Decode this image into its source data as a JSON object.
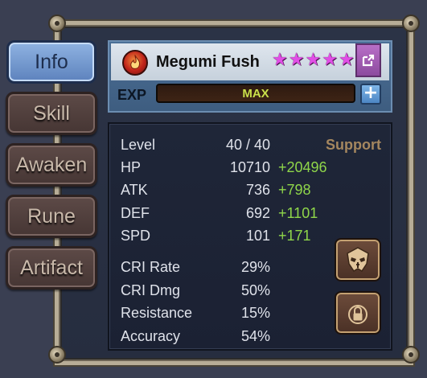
{
  "tabs": [
    {
      "label": "Info",
      "active": true
    },
    {
      "label": "Skill",
      "active": false
    },
    {
      "label": "Awaken",
      "active": false
    },
    {
      "label": "Rune",
      "active": false
    },
    {
      "label": "Artifact",
      "active": false
    }
  ],
  "monster": {
    "name": "Megumi Fush",
    "element_icon": "fire-element-icon",
    "stars": 6,
    "star_color": "#e14fe6"
  },
  "exp": {
    "label": "EXP",
    "bar_text": "MAX",
    "fill_fraction": 1.0
  },
  "role": "Support",
  "stats": [
    {
      "label": "Level",
      "value": "40 / 40",
      "bonus": ""
    },
    {
      "label": "HP",
      "value": "10710",
      "bonus": "+20496"
    },
    {
      "label": "ATK",
      "value": "736",
      "bonus": "+798"
    },
    {
      "label": "DEF",
      "value": "692",
      "bonus": "+1101"
    },
    {
      "label": "SPD",
      "value": "101",
      "bonus": "+171"
    }
  ],
  "secondary_stats": [
    {
      "label": "CRI Rate",
      "value": "29%"
    },
    {
      "label": "CRI Dmg",
      "value": "50%"
    },
    {
      "label": "Resistance",
      "value": "15%"
    },
    {
      "label": "Accuracy",
      "value": "54%"
    }
  ],
  "colors": {
    "active_tab": "#8fb3e2",
    "bonus_green": "#8fd64a",
    "role_text": "#a5875f",
    "exp_text": "#c9e04a"
  },
  "icons": {
    "share": "share-icon",
    "plus": "plus-icon",
    "skull": "skull-mask-icon",
    "lock": "lock-icon"
  }
}
